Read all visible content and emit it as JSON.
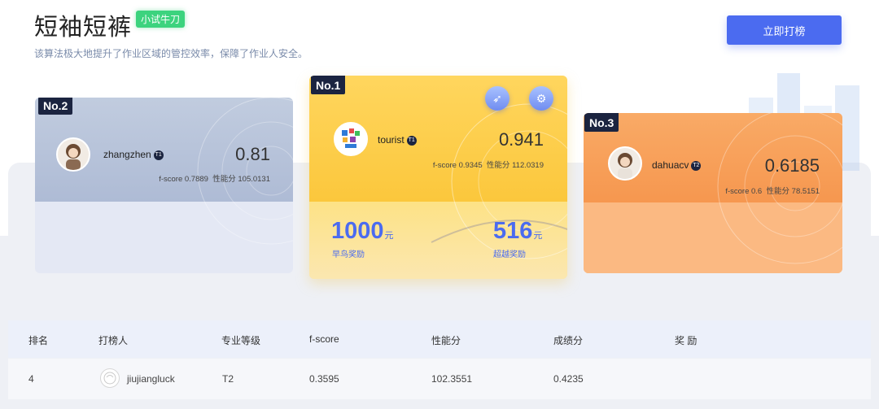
{
  "header": {
    "title": "短袖短裤",
    "tag": "小试牛刀",
    "description": "该算法极大地提升了作业区域的管控效率，保障了作业人安全。",
    "submit_button": "立即打榜"
  },
  "podium": {
    "first": {
      "rank": "No.1",
      "username": "tourist",
      "level": "T1",
      "score": "0.941",
      "fscore_label": "f-score",
      "fscore": "0.9345",
      "perf_label": "性能分",
      "perf": "112.0319",
      "reward_early": "1000",
      "reward_early_unit": "元",
      "reward_early_label": "早鸟奖励",
      "reward_beyond": "516",
      "reward_beyond_unit": "元",
      "reward_beyond_label": "超越奖励"
    },
    "second": {
      "rank": "No.2",
      "username": "zhangzhen",
      "level": "T1",
      "score": "0.81",
      "fscore_label": "f-score",
      "fscore": "0.7889",
      "perf_label": "性能分",
      "perf": "105.0131"
    },
    "third": {
      "rank": "No.3",
      "username": "dahuacv",
      "level": "T2",
      "score": "0.6185",
      "fscore_label": "f-score",
      "fscore": "0.6",
      "perf_label": "性能分",
      "perf": "78.5151"
    }
  },
  "table": {
    "headers": [
      "排名",
      "打榜人",
      "专业等级",
      "f-score",
      "性能分",
      "成绩分",
      "奖 励"
    ],
    "rows": [
      {
        "rank": "4",
        "user": "jiujiangluck",
        "level": "T2",
        "fscore": "0.3595",
        "perf": "102.3551",
        "grade": "0.4235",
        "reward": ""
      }
    ]
  },
  "colors": {
    "accent": "#4b6bf0",
    "tag_green": "#3cd37e",
    "gold": "#fbc73c",
    "orange": "#f6974f",
    "silver": "#aebbd5",
    "badge_dark": "#1b2440"
  }
}
